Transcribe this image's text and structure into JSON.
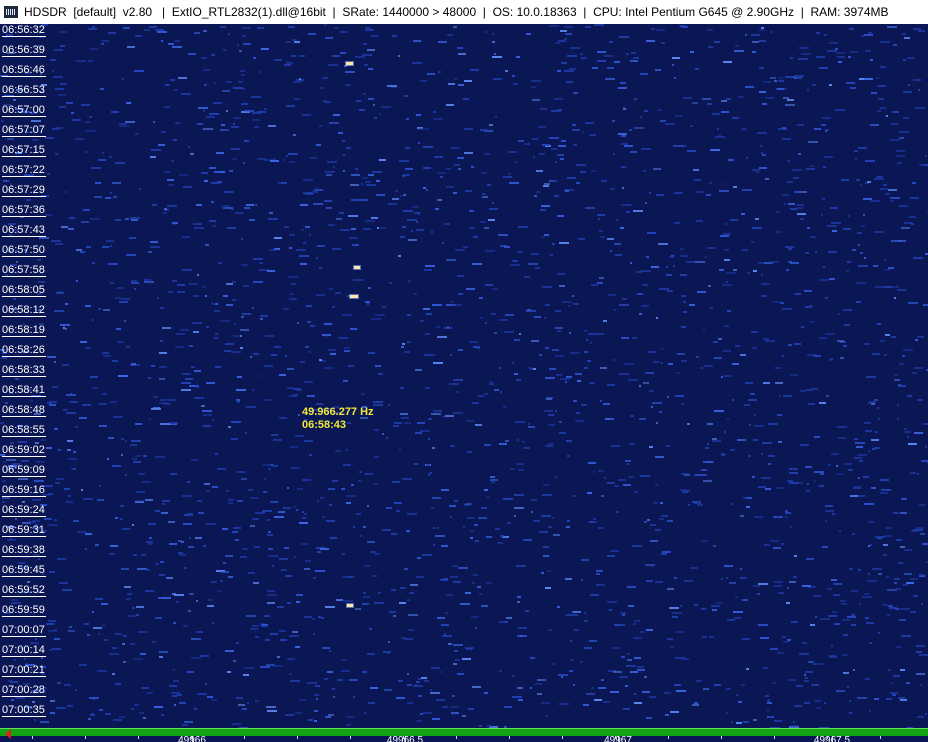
{
  "window": {
    "title": "HDSDR  [default]  v2.80   |  ExtIO_RTL2832(1).dll@16bit  |  SRate: 1440000 > 48000  |  OS: 10.0.18363  |  CPU: Intel Pentium G645 @ 2.90GHz  |  RAM: 3974MB"
  },
  "waterfall": {
    "time_labels": [
      "06:56:32",
      "06:56:39",
      "06:56:46",
      "06:56:53",
      "06:57:00",
      "06:57:07",
      "06:57:15",
      "06:57:22",
      "06:57:29",
      "06:57:36",
      "06:57:43",
      "06:57:50",
      "06:57:58",
      "06:58:05",
      "06:58:12",
      "06:58:19",
      "06:58:26",
      "06:58:33",
      "06:58:41",
      "06:58:48",
      "06:58:55",
      "06:59:02",
      "06:59:09",
      "06:59:16",
      "06:59:24",
      "06:59:31",
      "06:59:38",
      "06:59:45",
      "06:59:52",
      "06:59:59",
      "07:00:07",
      "07:00:14",
      "07:00:21",
      "07:00:28",
      "07:00:35"
    ],
    "cursor": {
      "frequency": "49.966.277 Hz",
      "time": "06:58:43"
    },
    "colors": {
      "background": "#0b1654",
      "noise": "#2a4fd0",
      "bright": "#ffe9a0"
    }
  },
  "frequency_scale": {
    "labels": [
      "49966",
      "49966.5",
      "49967",
      "49967.5"
    ],
    "colors": {
      "bar": "#12a312",
      "marker": "#e02020"
    }
  }
}
